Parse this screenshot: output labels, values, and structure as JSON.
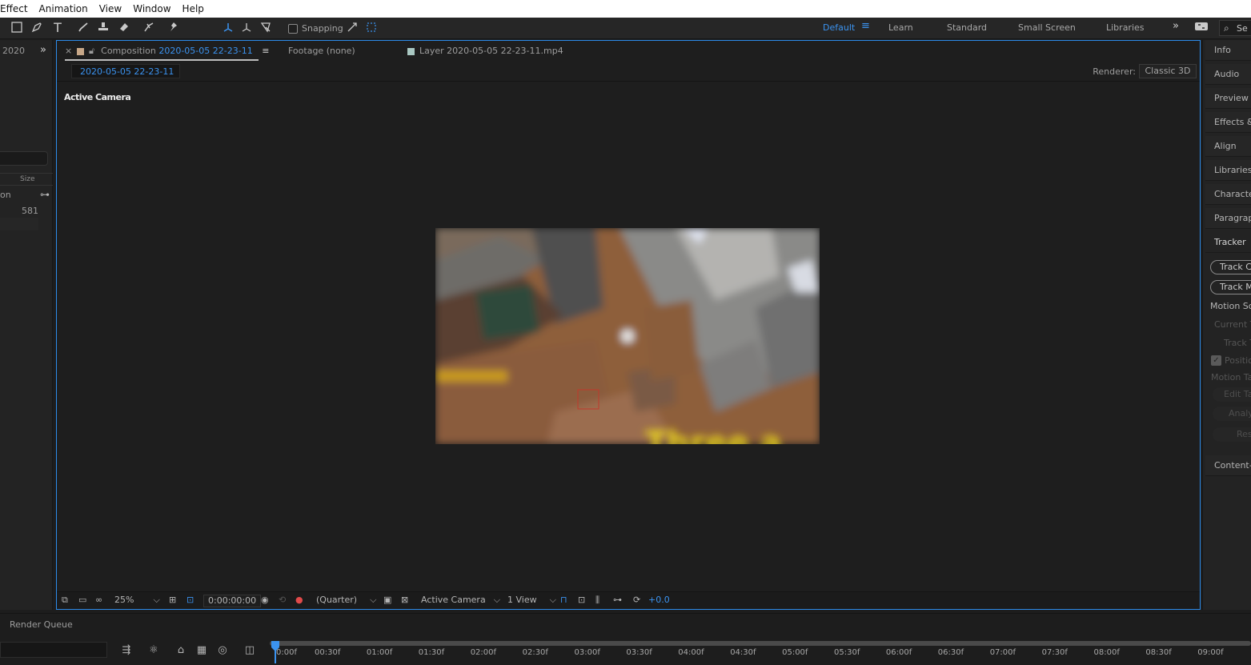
{
  "menu": [
    "Effect",
    "Animation",
    "View",
    "Window",
    "Help"
  ],
  "toolbar": {
    "snapping_label": "Snapping",
    "workspaces": [
      {
        "label": "Default",
        "active": true
      },
      {
        "label": "Learn",
        "active": false
      },
      {
        "label": "Standard",
        "active": false
      },
      {
        "label": "Small Screen",
        "active": false
      },
      {
        "label": "Libraries",
        "active": false
      }
    ],
    "search_label": "Se"
  },
  "project": {
    "tab_text": "2020",
    "column_size": "Size",
    "row_name": "on",
    "row_size": "581"
  },
  "composition": {
    "tab_label_prefix": "Composition",
    "tab_label_name": "2020-05-05 22-23-11",
    "footage_tab": "Footage (none)",
    "layer_tab": "Layer 2020-05-05 22-23-11.mp4",
    "comp_tag": "2020-05-05 22-23-11",
    "renderer_label": "Renderer:",
    "renderer_value": "Classic 3D",
    "active_camera_label": "Active Camera",
    "footer": {
      "zoom": "25%",
      "timecode": "0:00:00:00",
      "resolution": "(Quarter)",
      "view": "Active Camera",
      "views": "1 View",
      "exposure": "+0.0"
    },
    "frame_caption": "Three a"
  },
  "right_panel": {
    "items": [
      "Info",
      "Audio",
      "Preview",
      "Effects &",
      "Align",
      "Libraries",
      "Character",
      "Paragraph"
    ],
    "tracker_title": "Tracker",
    "track_buttons": [
      "Track Ca",
      "Track M"
    ],
    "motion_source": "Motion So",
    "current_track": "Current T",
    "track_type": "Track T",
    "position_label": "Positio",
    "motion_target": "Motion Ta",
    "edit_target": "Edit Ta",
    "analyze": "Analy",
    "reset": "Res",
    "content_aware": "Content-A"
  },
  "timeline": {
    "render_queue": "Render Queue",
    "ticks": [
      "0:00f",
      "00:30f",
      "01:00f",
      "01:30f",
      "02:00f",
      "02:30f",
      "03:00f",
      "03:30f",
      "04:00f",
      "04:30f",
      "05:00f",
      "05:30f",
      "06:00f",
      "06:30f",
      "07:00f",
      "07:30f",
      "08:00f",
      "08:30f",
      "09:00f"
    ]
  },
  "colors": {
    "accent": "#3b93f0",
    "panel_bg": "#1e1e1e",
    "menu_bg": "#ffffff"
  }
}
